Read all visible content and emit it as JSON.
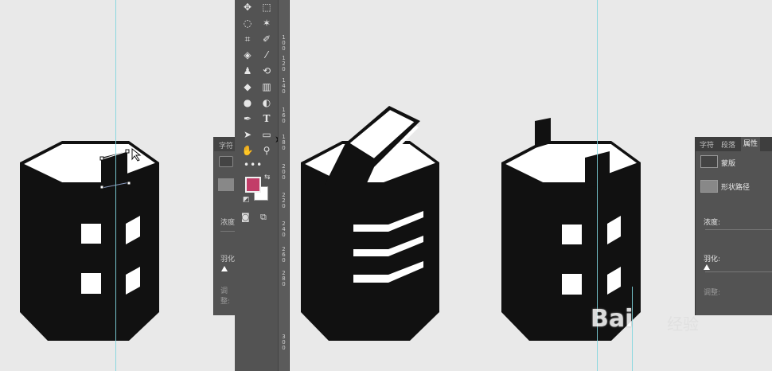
{
  "colors": {
    "canvas": "#e9e9e9",
    "panel": "#535353",
    "foreground_swatch": "#c23d68",
    "background_swatch": "#ffffff",
    "guide": "#7fd6df",
    "building": "#111111"
  },
  "toolbar": {
    "tools": [
      "move-tool",
      "marquee-tool",
      "lasso-tool",
      "magic-wand-tool",
      "crop-tool",
      "eyedropper-tool",
      "healing-brush-tool",
      "brush-tool",
      "clone-stamp-tool",
      "history-brush-tool",
      "eraser-tool",
      "gradient-tool",
      "blur-tool",
      "dodge-tool",
      "pen-tool",
      "type-tool",
      "path-selection-tool",
      "rectangle-tool",
      "hand-tool",
      "zoom-tool"
    ],
    "type_tool_glyph": "T",
    "more_glyph": "•••"
  },
  "ruler": {
    "labels": [
      "1\n0\n0",
      "1\n2\n0",
      "1\n4\n0",
      "1\n6\n0",
      "1\n8\n0",
      "2\n0\n0",
      "2\n2\n0",
      "2\n4\n0",
      "2\n6\n0",
      "2\n8\n0",
      "3\n0\n0"
    ]
  },
  "left_panel": {
    "tab_label": "字符",
    "density_label": "浓度",
    "feather_label": "羽化",
    "adjust_label": "调整:"
  },
  "right_panel": {
    "tabs": [
      "字符",
      "段落",
      "属性"
    ],
    "active_tab": "属性",
    "mask_label": "蒙版",
    "shape_path_label": "形状路径",
    "density_label": "浓度:",
    "feather_label": "羽化:",
    "adjust_label": "调整:"
  },
  "watermark": {
    "text": "Bai",
    "tail": "经验"
  }
}
